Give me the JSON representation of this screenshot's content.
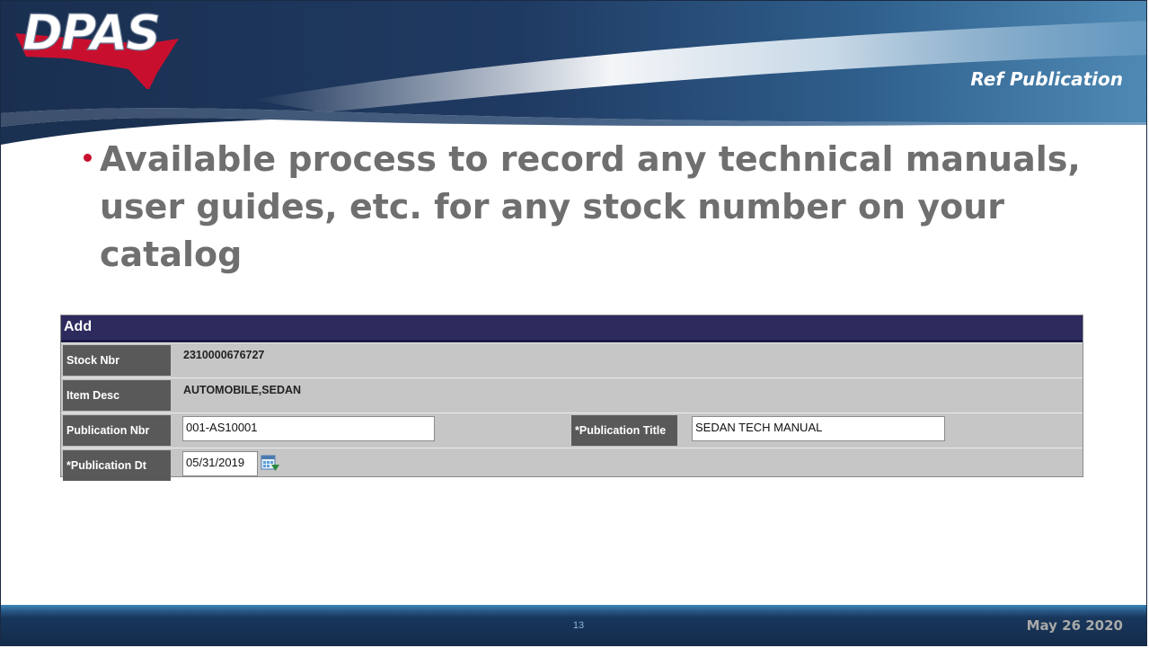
{
  "header": {
    "logo_text": "DPAS",
    "section_title": "Ref Publication"
  },
  "bullet": {
    "text": "Available process to record any technical manuals, user guides, etc. for any stock number on your catalog"
  },
  "form": {
    "header_label": "Add",
    "rows": [
      {
        "label": "Stock Nbr",
        "value": "2310000676727"
      },
      {
        "label": "Item Desc",
        "value": "AUTOMOBILE,SEDAN"
      }
    ],
    "publication_nbr": {
      "label": "Publication Nbr",
      "value": "001-AS10001"
    },
    "publication_title": {
      "label": "*Publication Title",
      "value": "SEDAN TECH MANUAL"
    },
    "publication_dt": {
      "label": "*Publication Dt",
      "value": "05/31/2019"
    }
  },
  "footer": {
    "page_number": "13",
    "date": "May 26 2020"
  },
  "colors": {
    "header_navy": "#1b3152",
    "bullet_red": "#c8102e",
    "form_header": "#2d2a5e",
    "label_bg": "#595959"
  }
}
